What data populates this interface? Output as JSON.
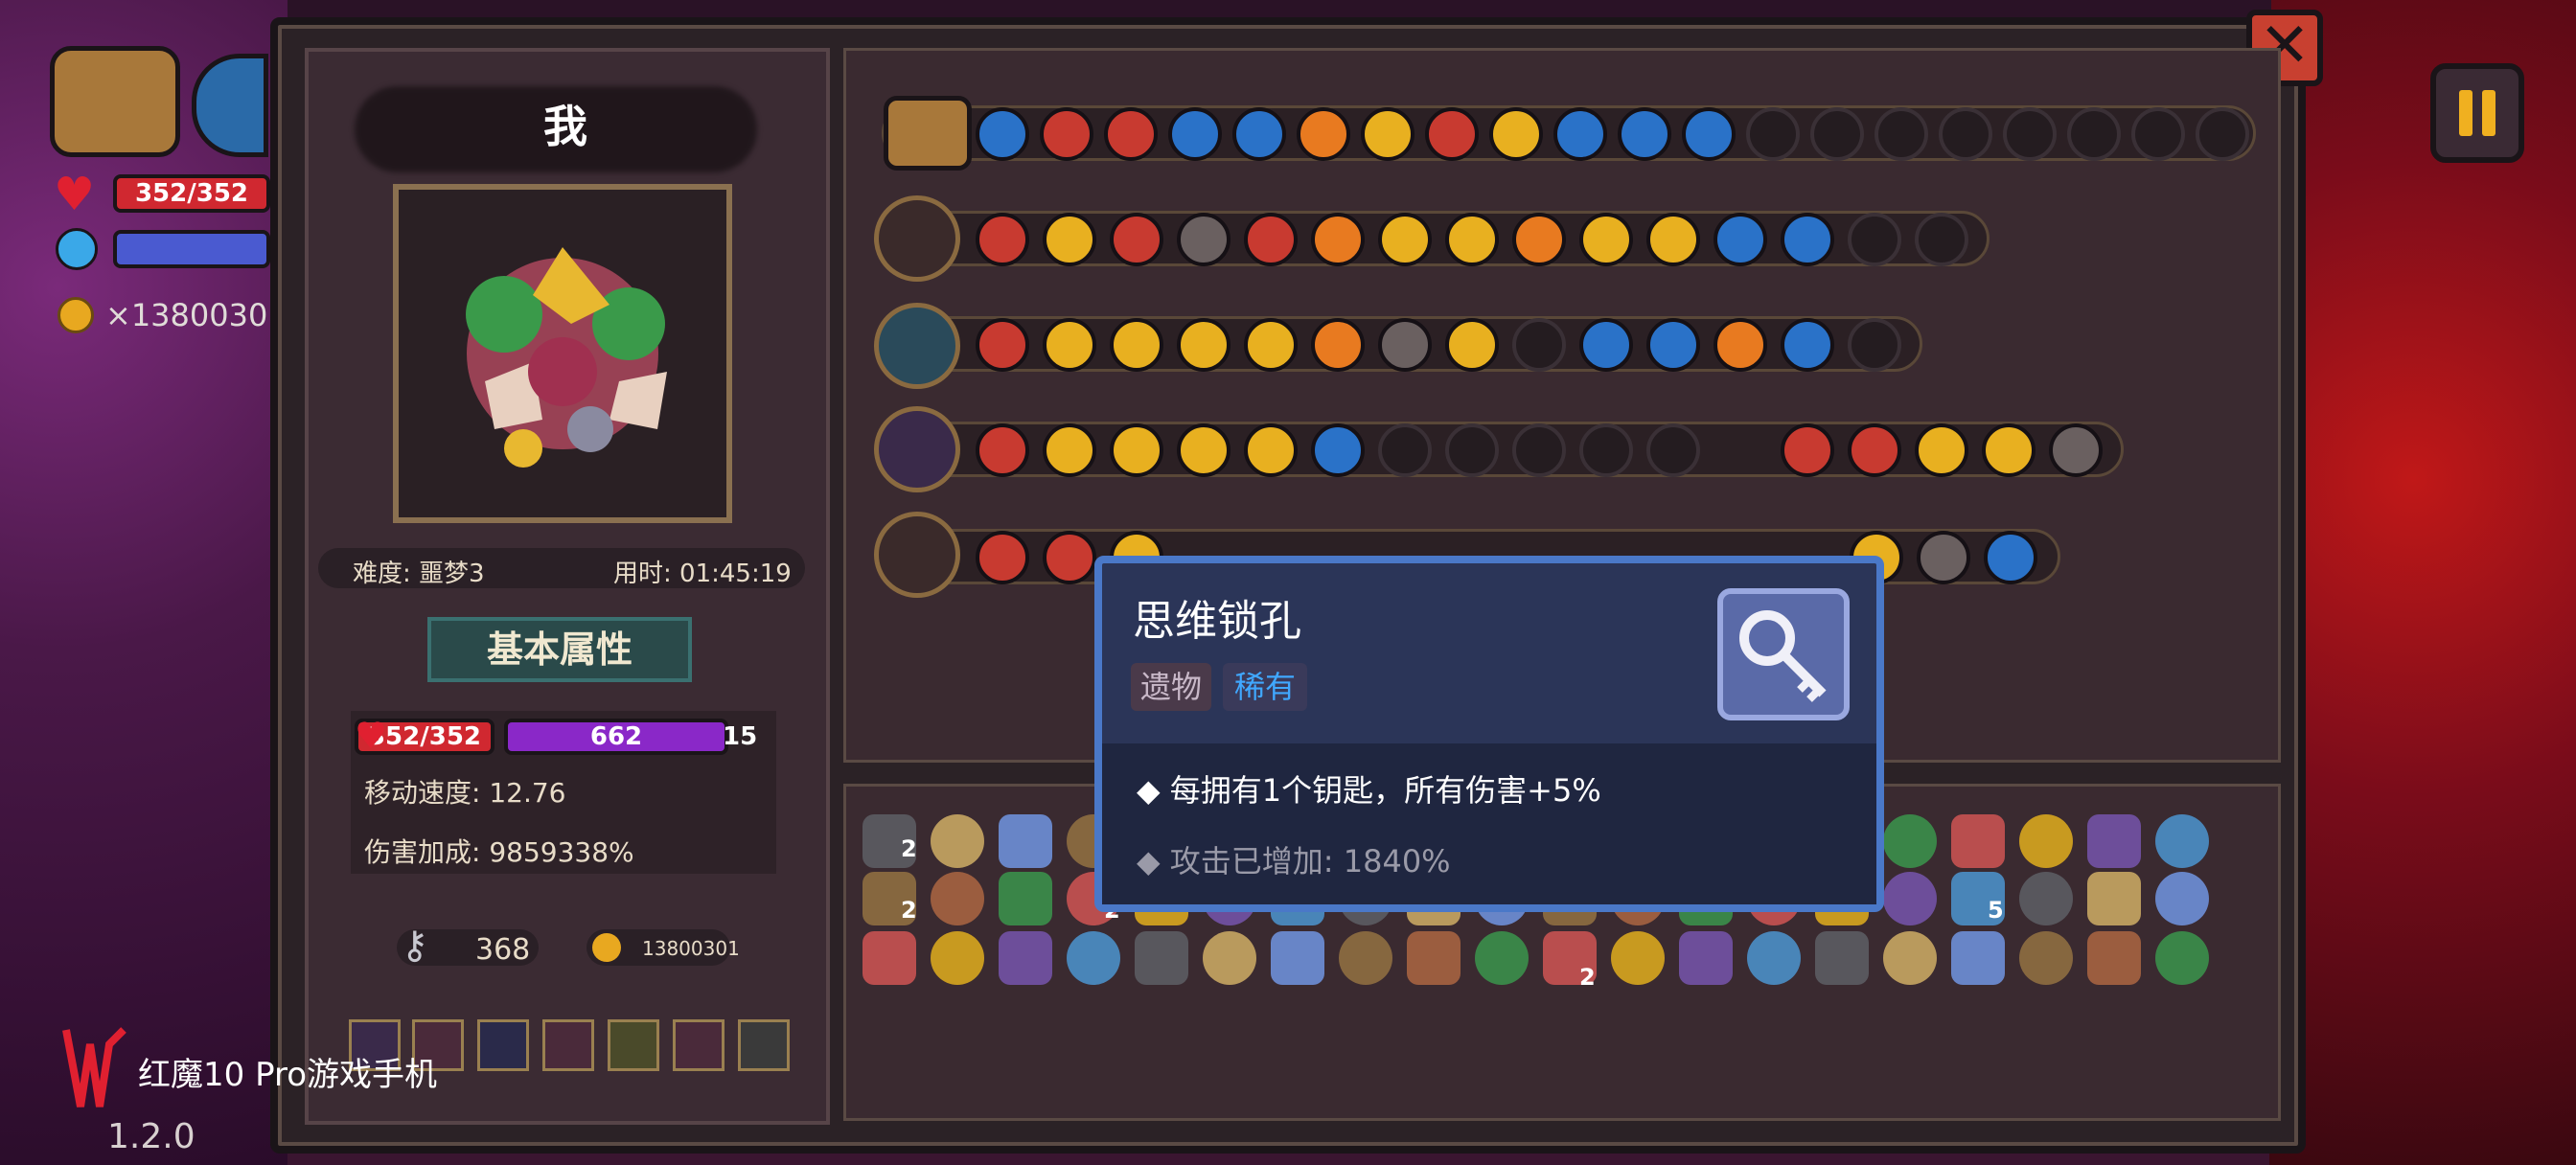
{
  "hud": {
    "hp_text": "352/352",
    "gold_text": "×1380030"
  },
  "player": {
    "name": "我",
    "difficulty": "难度: 噩梦3",
    "time": "用时: 01:45:19"
  },
  "attributes": {
    "section_label": "基本属性",
    "hp": "352/352",
    "mana": "662",
    "shield": "15",
    "move_speed": "移动速度: 12.76",
    "damage_bonus": "伤害加成: 9859338%"
  },
  "resources": {
    "keys": "368",
    "gold": "13800301"
  },
  "tooltip": {
    "title": "思维锁孔",
    "tag_type": "遗物",
    "tag_rarity": "稀有",
    "desc1": "每拥有1个钥匙，所有伤害+5%",
    "desc2": "攻击已增加: 1840%",
    "icon": "key-icon"
  },
  "inventory_counts": [
    "2",
    "2",
    "2",
    "5",
    "2"
  ],
  "brand": {
    "name": "红魔10 Pro游戏手机",
    "version": "1.2.0"
  },
  "colors": {
    "hp_red": "#d02830",
    "mana_purple": "#8a28c8",
    "tooltip_blue": "#4a78c8",
    "rarity_blue": "#40a8ff"
  }
}
